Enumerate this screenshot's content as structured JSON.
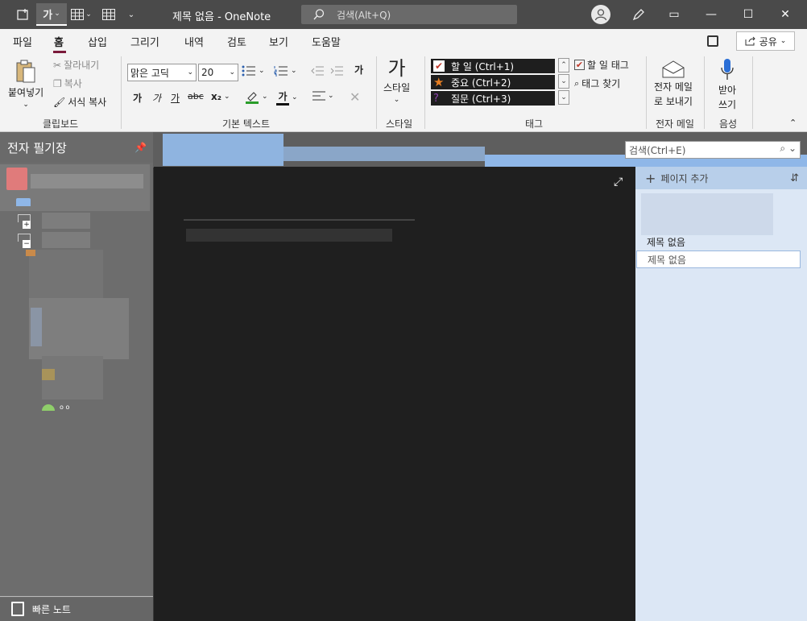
{
  "titlebar": {
    "font_label": "가",
    "title": "제목 없음  -  OneNote",
    "search_placeholder": "검색(Alt+Q)",
    "restore": "▭",
    "min": "—",
    "max": "☐",
    "close": "✕"
  },
  "menu": {
    "tabs": [
      "파일",
      "홈",
      "삽입",
      "그리기",
      "내역",
      "검토",
      "보기",
      "도움말"
    ],
    "share": "공유"
  },
  "ribbon": {
    "clipboard": {
      "paste": "붙여넣기",
      "cut": "잘라내기",
      "copy": "복사",
      "format_painter": "서식 복사",
      "label": "클립보드"
    },
    "basic_text": {
      "font": "맑은 고딕",
      "size": "20",
      "bold": "가",
      "italic": "가",
      "underline": "가",
      "strike": "abc",
      "subscript": "x₂",
      "font_color": "가",
      "label": "기본 텍스트"
    },
    "styles": {
      "glyph": "가",
      "button": "스타일",
      "label": "스타일"
    },
    "tags": {
      "items": [
        {
          "label": "할 일 (Ctrl+1)"
        },
        {
          "label": "중요 (Ctrl+2)"
        },
        {
          "label": "질문 (Ctrl+3)"
        }
      ],
      "todo_tag": "할 일 태그",
      "find_tags": "태그 찾기",
      "label": "태그"
    },
    "email": {
      "button_line1": "전자 메일",
      "button_line2": "로 보내기",
      "label": "전자 메일"
    },
    "voice": {
      "button_line1": "받아",
      "button_line2": "쓰기",
      "label": "음성"
    }
  },
  "sidebar": {
    "title": "전자 필기장",
    "quick_notes": "빠른 노트"
  },
  "pages": {
    "search_placeholder": "검색(Ctrl+E)",
    "add_page": "페이지 추가",
    "items": [
      "제목 없음",
      "제목 없음"
    ]
  }
}
